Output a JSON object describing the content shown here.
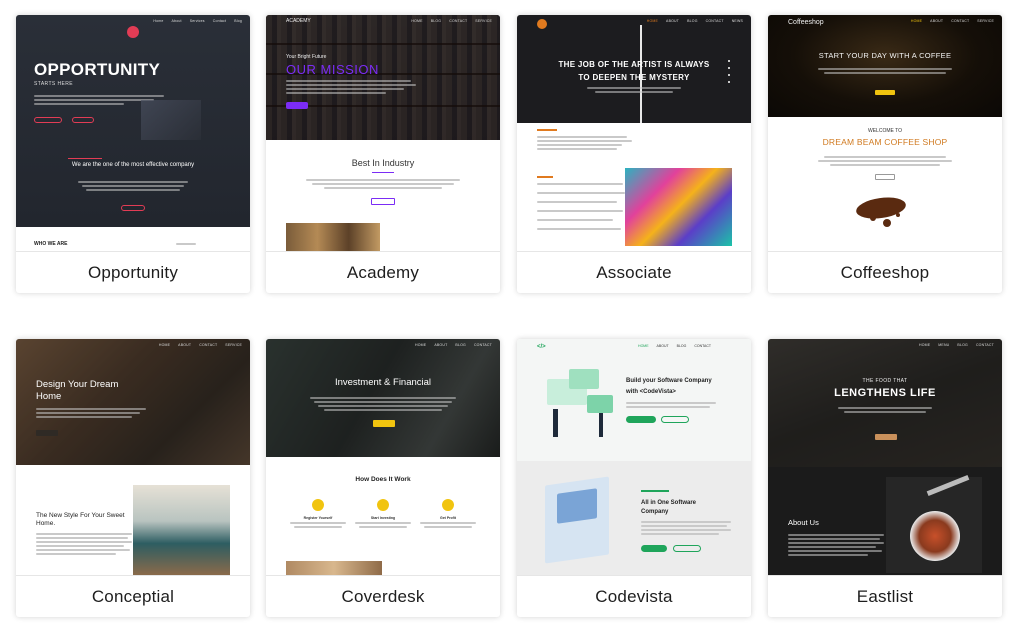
{
  "cards": [
    {
      "name": "Opportunity",
      "hero_title": "OPPORTUNITY",
      "hero_sub": "STARTS HERE",
      "tagline": "We are the one of the most effective company",
      "footer_left": "WHO WE ARE"
    },
    {
      "name": "Academy",
      "brand": "ACADEMY",
      "hero_small": "Your Bright Future",
      "hero_title": "OUR MISSION",
      "section_title": "Best In Industry"
    },
    {
      "name": "Associate",
      "hero_line1": "THE JOB OF THE ARTIST IS ALWAYS",
      "hero_line2": "TO DEEPEN THE MYSTERY"
    },
    {
      "name": "Coffeeshop",
      "brand": "Coffeeshop",
      "hero_title": "START YOUR DAY WITH A COFFEE",
      "welcome": "WELCOME TO",
      "section_title": "DREAM BEAM COFFEE SHOP"
    },
    {
      "name": "Conceptial",
      "hero_title_1": "Design Your Dream",
      "hero_title_2": "Home",
      "section_title_1": "The New Style For Your Sweet",
      "section_title_2": "Home."
    },
    {
      "name": "Coverdesk",
      "hero_title": "Investment & Financial",
      "section_title": "How Does It Work",
      "steps": [
        "Register Yourself",
        "Start Investing",
        "Get Profit"
      ]
    },
    {
      "name": "Codevista",
      "nav": [
        "HOME",
        "ABOUT",
        "BLOG",
        "CONTACT"
      ],
      "hero_line1": "Build your Software Company",
      "hero_line2": "with <CodeVista>",
      "section_title_1": "All in One Software",
      "section_title_2": "Company"
    },
    {
      "name": "Eastlist",
      "hero_small": "THE FOOD THAT",
      "hero_title": "LENGTHENS LIFE",
      "section_title": "About Us"
    }
  ],
  "colors": {
    "academy_mission": "#7b2cf5",
    "associate_accent": "#e07a1f",
    "coffee_title": "#d07a20",
    "codevista_green": "#1fa55b",
    "opportunity_accent": "#e23c55"
  }
}
